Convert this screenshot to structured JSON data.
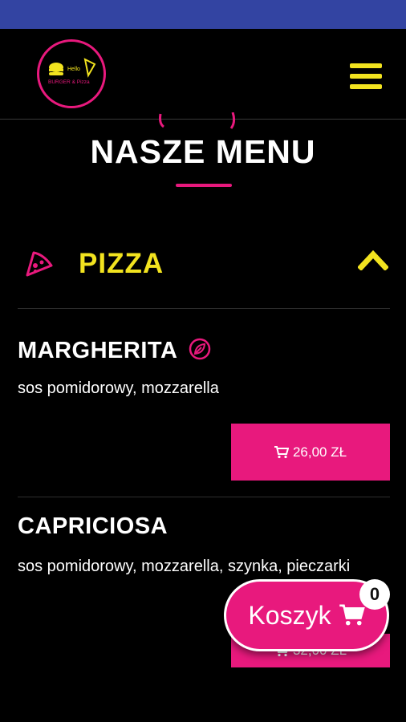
{
  "header": {
    "logo_text_top": "Hello",
    "logo_text_bottom": "BURGER & Pizza",
    "menu_icon": "hamburger-menu-icon"
  },
  "section": {
    "title": "NASZE MENU"
  },
  "category": {
    "label": "PIZZA",
    "icon": "pizza-slice-icon",
    "expanded_icon": "chevron-up-icon"
  },
  "items": [
    {
      "name": "MARGHERITA",
      "vegetarian_icon": "leaf-icon",
      "description": "sos pomidorowy, mozzarella",
      "price": "26,00 ZŁ"
    },
    {
      "name": "CAPRICIOSA",
      "description": "sos pomidorowy, mozzarella, szynka, pieczarki",
      "price": "32,00 ZŁ"
    }
  ],
  "cart": {
    "label": "Koszyk",
    "count": "0",
    "icon": "cart-icon"
  },
  "colors": {
    "status_bar": "#3344a2",
    "accent_pink": "#e8197d",
    "accent_yellow": "#f2e31f",
    "background": "#000000"
  }
}
